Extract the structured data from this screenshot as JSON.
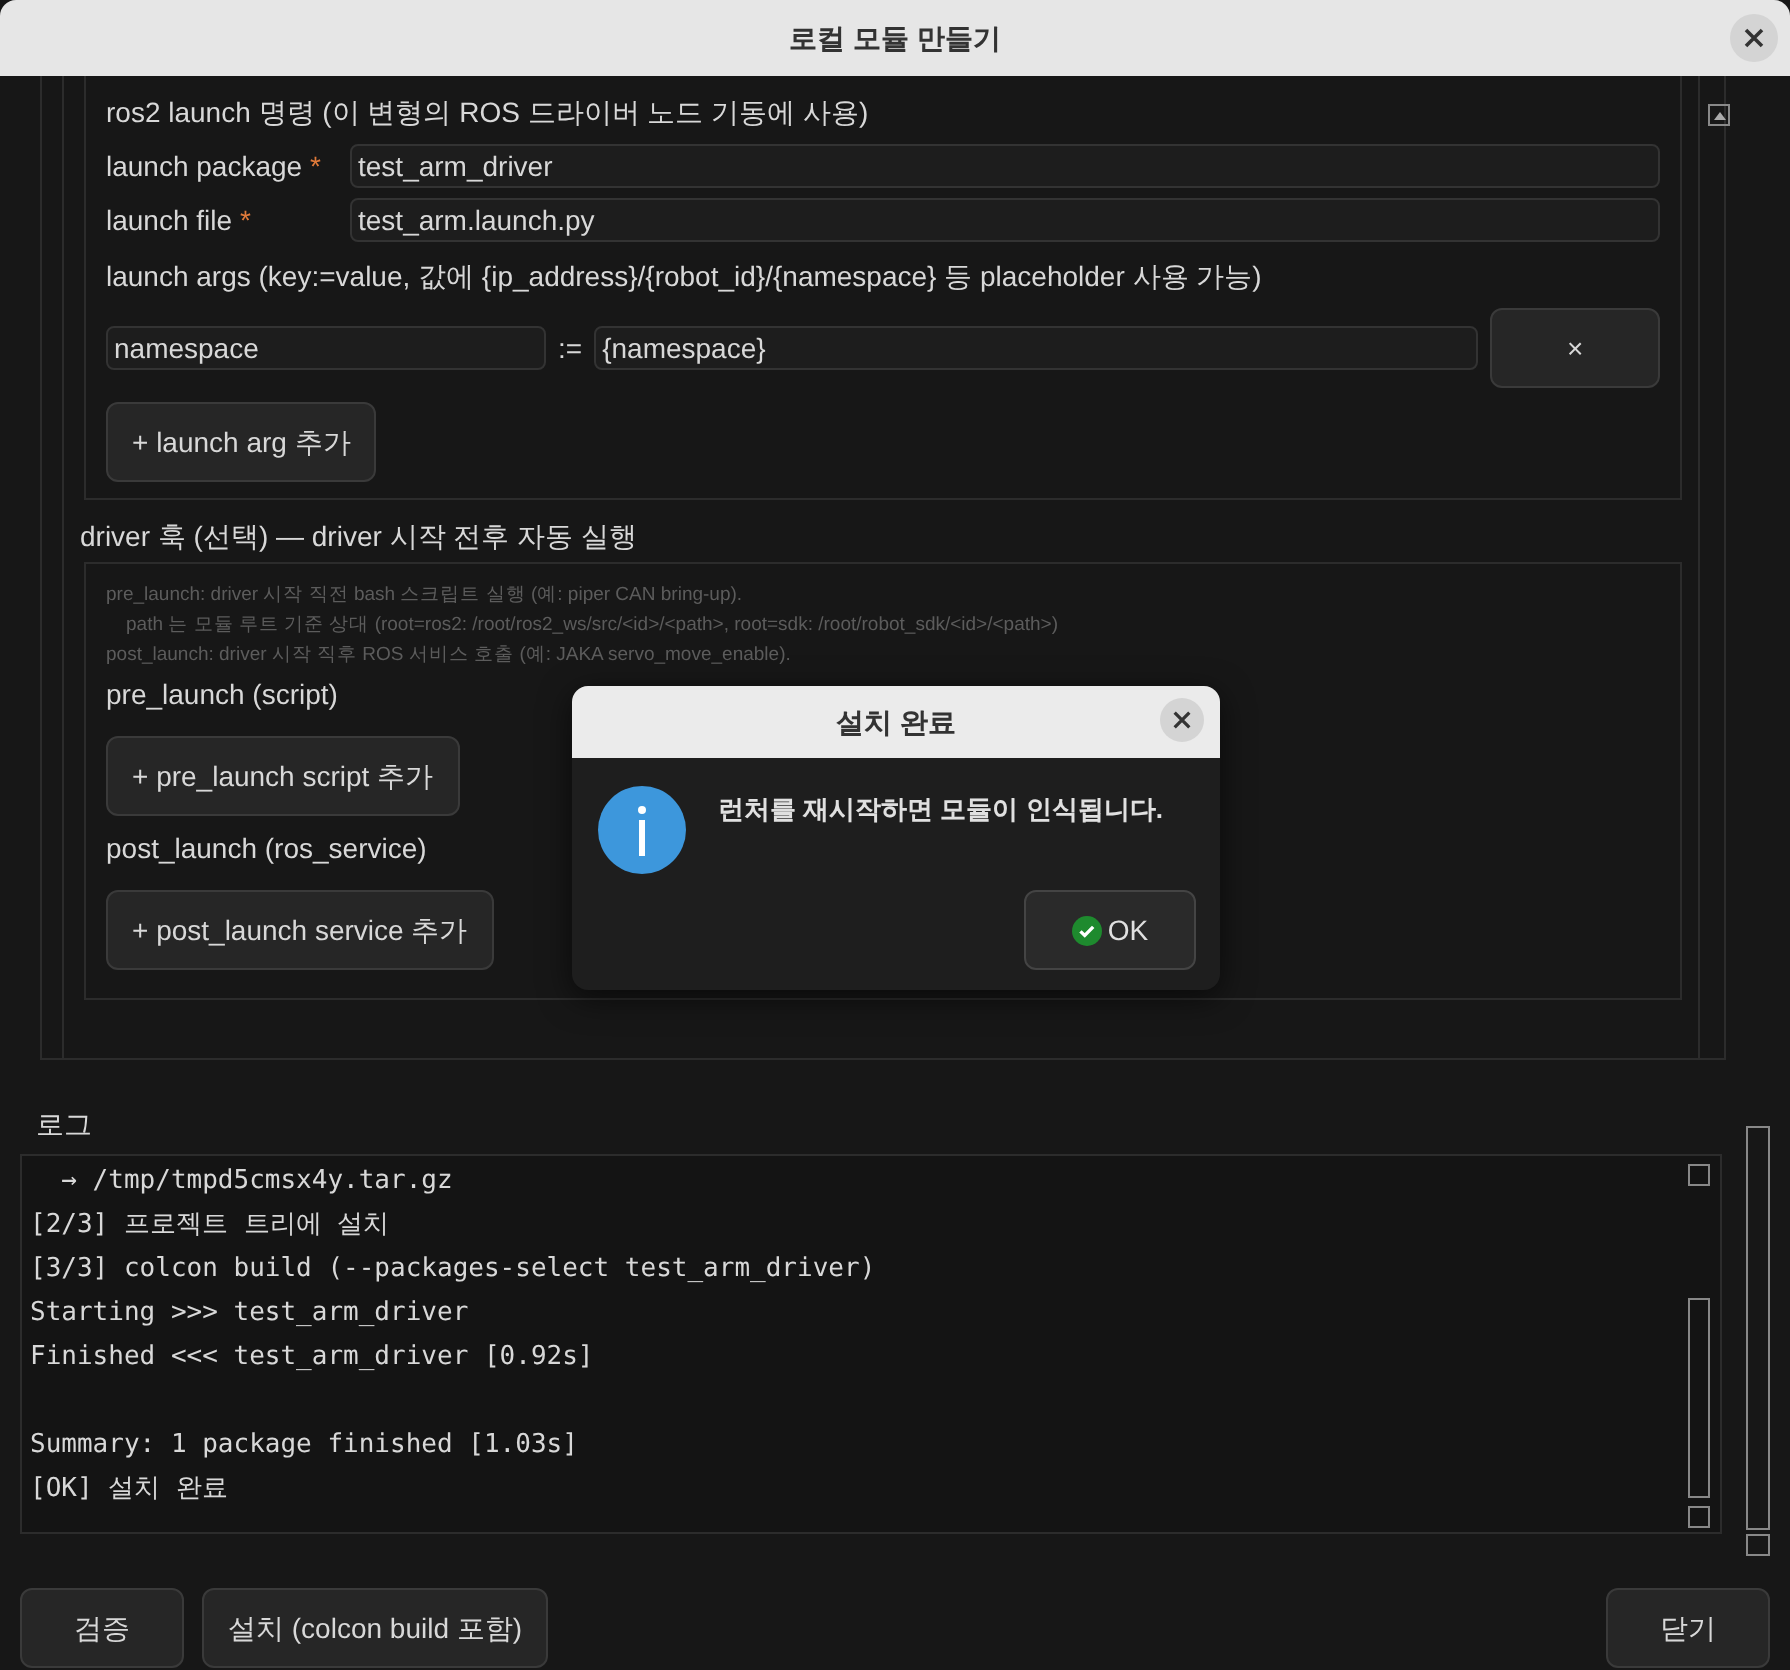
{
  "window": {
    "title": "로컬 모듈 만들기"
  },
  "launch_section": {
    "heading": "ros2 launch 명령 (이 변형의 ROS 드라이버 노드 기동에 사용)",
    "fields": [
      {
        "label": "launch package",
        "required_mark": "*",
        "value": "test_arm_driver"
      },
      {
        "label": "launch file",
        "required_mark": "*",
        "value": "test_arm.launch.py"
      }
    ],
    "args_label": "launch args (key:=value, 값에 {ip_address}/{robot_id}/{namespace} 등 placeholder 사용 가능)",
    "args": [
      {
        "key": "namespace",
        "operator": ":=",
        "value": "{namespace}",
        "remove": "×"
      }
    ],
    "add_button": "+ launch arg 추가"
  },
  "hooks_section": {
    "title": "driver 훅 (선택) — driver 시작 전후 자동 실행",
    "help_lines": [
      {
        "text": "pre_launch: driver 시작 직전 bash 스크립트 실행 (예: piper CAN bring-up).",
        "indented": false
      },
      {
        "text": "path 는 모듈 루트 기준 상대 (root=ros2: /root/ros2_ws/src/<id>/<path>, root=sdk: /root/robot_sdk/<id>/<path>)",
        "indented": true
      },
      {
        "text": "post_launch: driver 시작 직후 ROS 서비스 호출 (예: JAKA servo_move_enable).",
        "indented": false
      }
    ],
    "pre_label": "pre_launch (script)",
    "pre_button": "+ pre_launch script 추가",
    "post_label": "post_launch (ros_service)",
    "post_button": "+ post_launch service 추가"
  },
  "log": {
    "label": "로그",
    "lines": [
      {
        "text": "  → /tmp/tmpd5cmsx4y.tar.gz",
        "gap_before": false
      },
      {
        "text": "[2/3] 프로젝트 트리에 설치",
        "gap_before": false
      },
      {
        "text": "[3/3] colcon build (--packages-select test_arm_driver)",
        "gap_before": false
      },
      {
        "text": "Starting >>> test_arm_driver",
        "gap_before": false
      },
      {
        "text": "Finished <<< test_arm_driver [0.92s]",
        "gap_before": false
      },
      {
        "text": "Summary: 1 package finished [1.03s]",
        "gap_before": true
      },
      {
        "text": "[OK] 설치 완료",
        "gap_before": false
      }
    ]
  },
  "buttons": [
    "검증",
    "설치 (colcon build 포함)",
    "닫기"
  ],
  "dialog": {
    "title": "설치 완료",
    "message": "런처를 재시작하면 모듈이 인식됩니다.",
    "ok": "OK"
  }
}
